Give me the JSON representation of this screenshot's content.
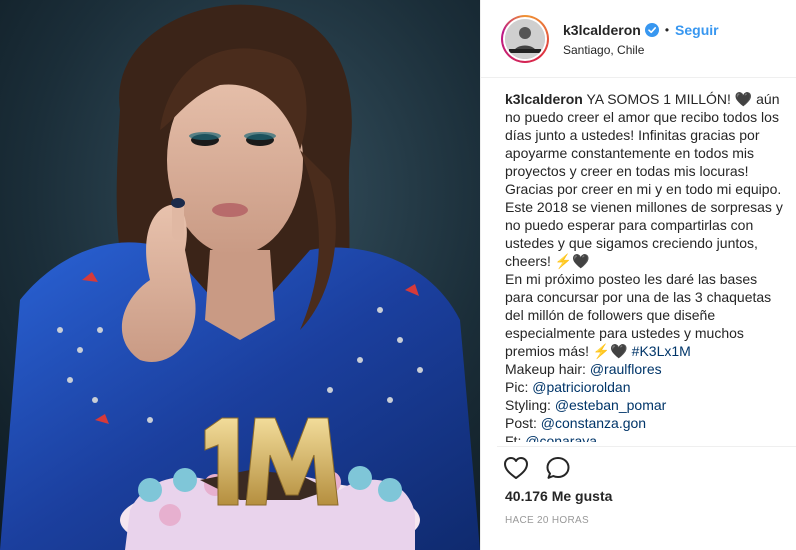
{
  "post": {
    "image_alt": "",
    "badge_text": "1M"
  },
  "header": {
    "username": "k3lcalderon",
    "separator": "•",
    "follow_label": "Seguir",
    "location": "Santiago, Chile"
  },
  "caption": {
    "username": "k3lcalderon",
    "lines": [
      "YA SOMOS 1 MILLÓN! 🖤 aún no puedo creer el amor que recibo todos los días junto a ustedes! Infinitas gracias por apoyarme constantemente en todos mis proyectos y creer en todas mis locuras! Gracias por creer en mi y en todo mi equipo. Este 2018 se vienen millones de sorpresas y no puedo esperar para compartirlas con ustedes y que sigamos creciendo juntos, cheers! ⚡🖤",
      "En mi próximo posteo les daré las bases para concursar por una de las 3 chaquetas del millón de followers que diseñe especialmente para ustedes y muchos premios más! ⚡🖤"
    ],
    "hashtag": "#K3Lx1M",
    "credits": [
      {
        "label": "Makeup hair:",
        "handle": "@raulflores"
      },
      {
        "label": "Pic:",
        "handle": "@patricioroldan"
      },
      {
        "label": "Styling:",
        "handle": "@esteban_pomar"
      },
      {
        "label": "Post:",
        "handle": "@constanza.gon"
      },
      {
        "label": "Ft:",
        "handle": "@conaraya"
      }
    ]
  },
  "actions": {
    "like_icon": "heart-icon",
    "comment_icon": "comment-icon"
  },
  "stats": {
    "likes": "40.176 Me gusta",
    "time": "HACE 20 HORAS"
  },
  "colors": {
    "follow": "#3897f0",
    "link": "#003569",
    "verified": "#3897f0",
    "muted": "#999999"
  }
}
